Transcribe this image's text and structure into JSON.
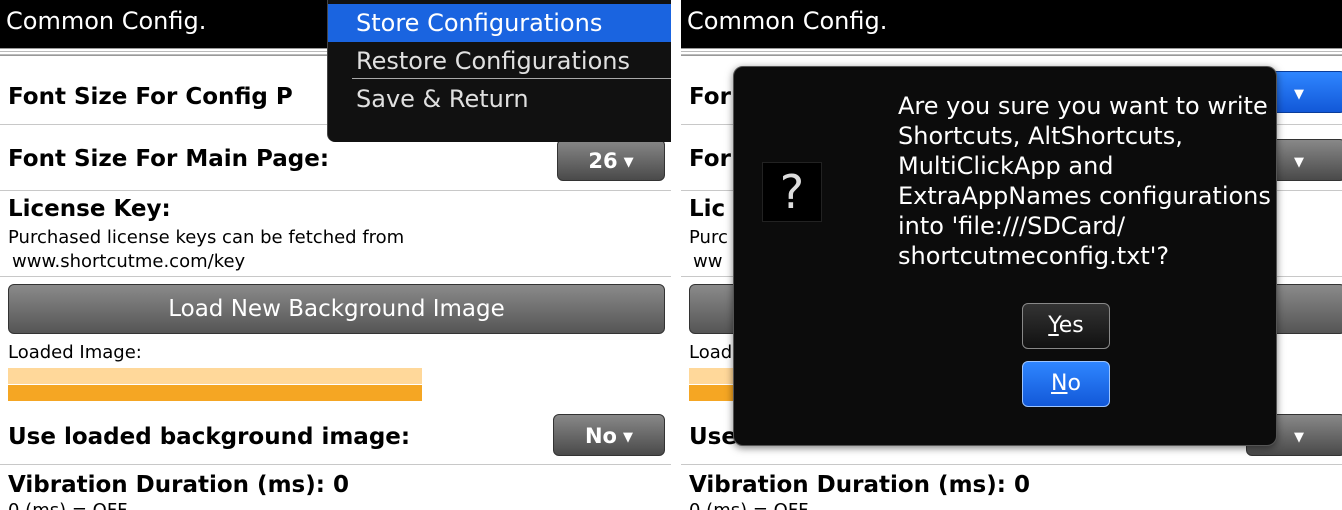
{
  "left": {
    "title": "Common Config.",
    "font_size_config_label": "Font Size For Config P",
    "font_size_main_label": "Font Size For Main Page:",
    "font_size_main_value": "26",
    "license_label": "License Key:",
    "license_desc_1": "Purchased license keys can be fetched from",
    "license_desc_2": "www.shortcutme.com/key",
    "load_bg_button": "Load New Background Image",
    "loaded_image_label": "Loaded Image:",
    "use_bg_label": "Use loaded background image:",
    "use_bg_value": "No",
    "vibration_label": "Vibration Duration (ms): 0",
    "vibration_desc": "0 (ms)      = OFF",
    "menu": {
      "store": "Store Configurations",
      "restore": "Restore Configurations",
      "save_return": "Save & Return"
    }
  },
  "right": {
    "title": "Common Config.",
    "label_font_1": "For",
    "label_font_2": "For",
    "label_license": "Lic",
    "desc_1": "Purc",
    "desc_2": "ww",
    "label_loaded": "Load",
    "label_use": "Use",
    "vibration_label": "Vibration Duration (ms): 0",
    "vibration_desc": "0 (ms)      = OFF",
    "dialog": {
      "icon": "?",
      "message_lines": [
        "Are you sure you want to write",
        "Shortcuts, AltShortcuts,",
        "MultiClickApp and",
        "ExtraAppNames configurations",
        "into 'file:///SDCard/",
        "shortcutmeconfig.txt'?"
      ],
      "yes_accel": "Y",
      "yes_rest": "es",
      "no_accel": "N",
      "no_rest": "o"
    }
  },
  "colors": {
    "menu_highlight": "#1a64e0",
    "image_bar_light": "#ffd89a",
    "image_bar_dark": "#f5a623",
    "dialog_bg": "#0c0c0c"
  }
}
